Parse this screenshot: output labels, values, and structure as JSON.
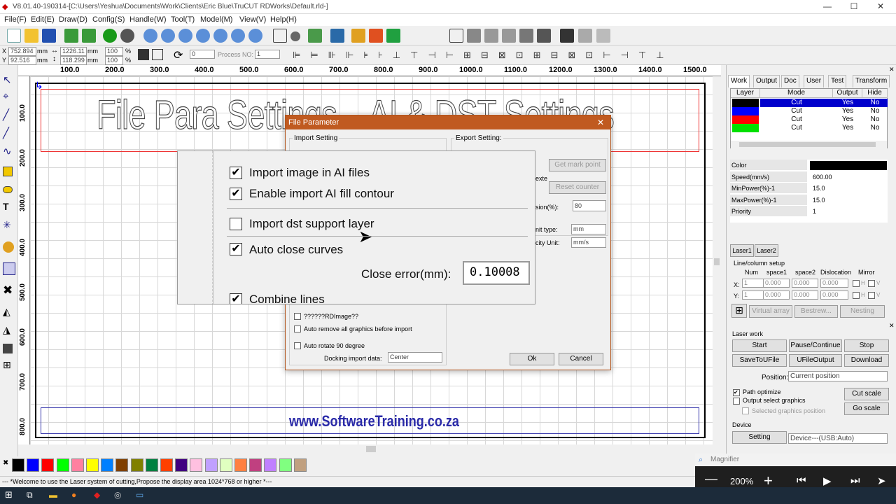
{
  "window": {
    "title": "V8.01.40-190314-[C:\\Users\\Yeshua\\Documents\\Work\\Clients\\Eric Blue\\TruCUT RDWorks\\Default.rld-]",
    "min": "—",
    "max": "☐",
    "close": "✕"
  },
  "menu": [
    "File(F)",
    "Edit(E)",
    "Draw(D)",
    "Config(S)",
    "Handle(W)",
    "Tool(T)",
    "Model(M)",
    "View(V)",
    "Help(H)"
  ],
  "coords": {
    "x_label": "X",
    "x_value": "752.894",
    "x_unit": "mm",
    "y_label": "Y",
    "y_value": "92.516",
    "y_unit": "mm",
    "w_value": "1226.11",
    "w_unit": "mm",
    "h_value": "118.299",
    "h_unit": "mm",
    "pct1": "100",
    "pct2": "100",
    "pct_unit": "%",
    "angle": "0",
    "process_label": "Process NO:",
    "process_value": "1"
  },
  "ruler_top": [
    "100.0",
    "200.0",
    "300.0",
    "400.0",
    "500.0",
    "600.0",
    "700.0",
    "800.0",
    "900.0",
    "1000.0",
    "1100.0",
    "1200.0",
    "1300.0",
    "1400.0",
    "1500.0"
  ],
  "ruler_left": [
    "100.0",
    "200.0",
    "300.0",
    "400.0",
    "500.0",
    "600.0",
    "700.0",
    "800.0"
  ],
  "canvas": {
    "title_text": "File Para Settings – AI & DST Settings",
    "website_text": "www.SoftwareTraining.co.za"
  },
  "status_text": "--- *Welcome to use the Laser system of cutting,Propose the display area 1024*768 or higher *---",
  "right_panel": {
    "tabs": [
      "Work",
      "Output",
      "Doc",
      "User",
      "Test",
      "Transform"
    ],
    "layer_headers": [
      "Layer",
      "Mode",
      "Output",
      "Hide"
    ],
    "layers": [
      {
        "color": "#000000",
        "mode": "Cut",
        "output": "Yes",
        "hide": "No"
      },
      {
        "color": "#0000ff",
        "mode": "Cut",
        "output": "Yes",
        "hide": "No"
      },
      {
        "color": "#ff0000",
        "mode": "Cut",
        "output": "Yes",
        "hide": "No"
      },
      {
        "color": "#00e000",
        "mode": "Cut",
        "output": "Yes",
        "hide": "No"
      }
    ],
    "props": [
      {
        "k": "Color",
        "v": ""
      },
      {
        "k": "Speed(mm/s)",
        "v": "600.00"
      },
      {
        "k": "MinPower(%)-1",
        "v": "15.0"
      },
      {
        "k": "MaxPower(%)-1",
        "v": "15.0"
      },
      {
        "k": "Priority",
        "v": "1"
      }
    ],
    "laser_tabs": [
      "Laser1",
      "Laser2"
    ],
    "line_column_setup": "Line/column setup",
    "lc_headers": [
      "Num",
      "space1",
      "space2",
      "Dislocation",
      "Mirror"
    ],
    "x_label": "X:",
    "y_label": "Y:",
    "lc_x": [
      "1",
      "0.000",
      "0.000",
      "0.000"
    ],
    "lc_y": [
      "1",
      "0.000",
      "0.000",
      "0.000"
    ],
    "mirror_h": "H",
    "mirror_v": "V",
    "virtual_array": "Virtual array",
    "bestrew": "Bestrew...",
    "nesting": "Nesting",
    "laser_work": "Laser work",
    "start": "Start",
    "pause": "Pause/Continue",
    "stop": "Stop",
    "save_u": "SaveToUFile",
    "ufile_output": "UFileOutput",
    "download": "Download",
    "position_label": "Position:",
    "position_value": "Current position",
    "path_opt": "Path optimize",
    "output_select": "Output select graphics",
    "selected_pos": "Selected graphics position",
    "cut_scale": "Cut scale",
    "go_scale": "Go scale",
    "device_label": "Device",
    "setting": "Setting",
    "device_value": "Device---(USB:Auto)"
  },
  "dialog": {
    "title": "File Parameter",
    "import_setting": "Import Setting",
    "export_setting": "Export Setting:",
    "get_mark_point": "Get mark point",
    "reset_counter": "Reset counter",
    "frag_texte": "exte",
    "precision_frag": "sion(%):",
    "precision_value": "80",
    "unit_type_frag": "nit type:",
    "unit_type_value": "mm",
    "velocity_frag": "city Unit:",
    "velocity_value": "mm/s",
    "rdimage": "??????RDImage??",
    "auto_remove": "Auto remove all graphics before import",
    "auto_rotate": "Auto rotate 90 degree",
    "docking_label": "Docking import data:",
    "docking_value": "Center",
    "ok": "Ok",
    "cancel": "Cancel"
  },
  "magnified": {
    "opt1": "Import image in AI files",
    "opt2": "Enable import AI fill contour",
    "opt3": "Import dst support layer",
    "opt4": "Auto close curves",
    "close_error_label": "Close error(mm):",
    "close_error_value": "0.10008",
    "opt5": "Combine lines"
  },
  "magnifier": {
    "title": "Magnifier",
    "zoom": "200%",
    "minus": "—",
    "plus": "+"
  },
  "palette_colors": [
    "#000000",
    "#0000ff",
    "#ff0000",
    "#00ff00",
    "#ff80a0",
    "#ffff00",
    "#0080ff",
    "#804000",
    "#808000",
    "#008040",
    "#ff4000",
    "#400080",
    "#ffc0e0",
    "#c0a0ff",
    "#e0ffc0",
    "#ff8040",
    "#c04080",
    "#c080ff",
    "#80ff80",
    "#c0a080"
  ]
}
